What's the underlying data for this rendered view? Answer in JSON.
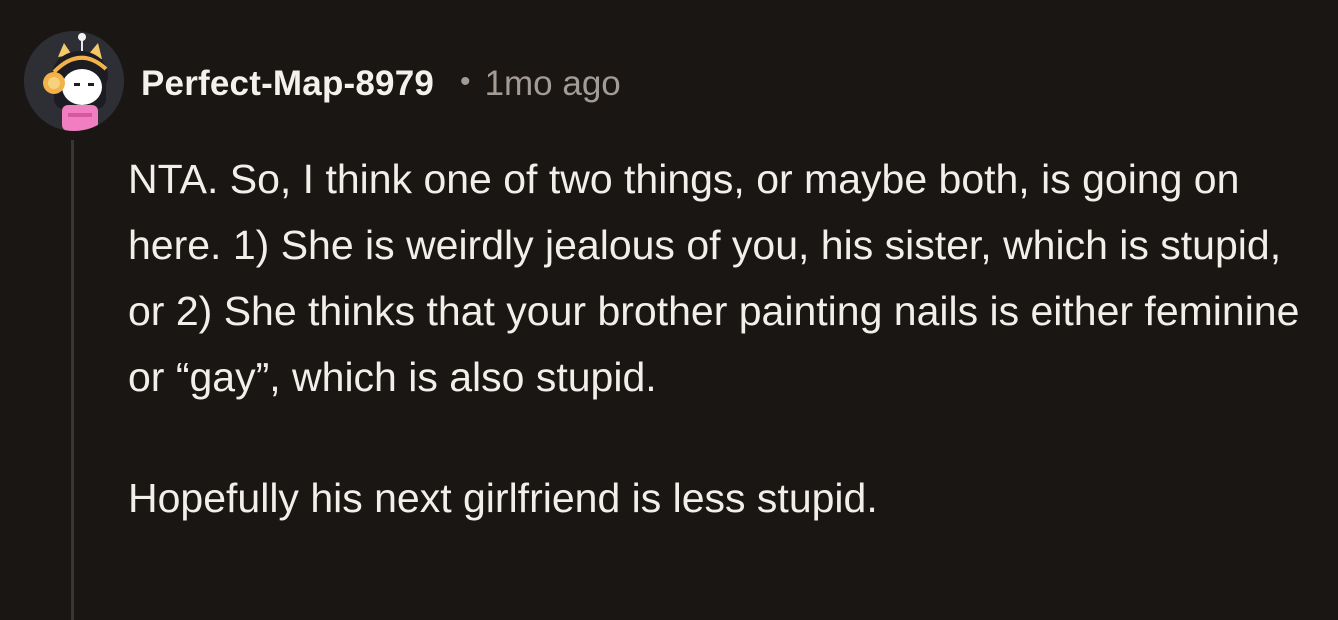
{
  "comment": {
    "author": "Perfect-Map-8979",
    "separator": "•",
    "timestamp": "1mo ago",
    "avatar": {
      "icon": "snoo-avatar-icon",
      "description_colors": {
        "background": "#2e2e35",
        "shirt": "#f07ec0",
        "hair": "#1c1c22",
        "ears": "#f5c86a"
      }
    },
    "paragraphs": [
      "NTA. So, I think one of two things, or maybe both, is going on here. 1) She is weirdly jealous of you, his sister, which is stupid, or 2) She thinks that your brother painting nails is either feminine or “gay”, which is also stupid.",
      "Hopefully his next girlfriend is less stupid."
    ]
  },
  "colors": {
    "background": "#1a1614",
    "text": "#f2eeea",
    "meta": "#a39b95",
    "thread_line": "#3a3634"
  }
}
